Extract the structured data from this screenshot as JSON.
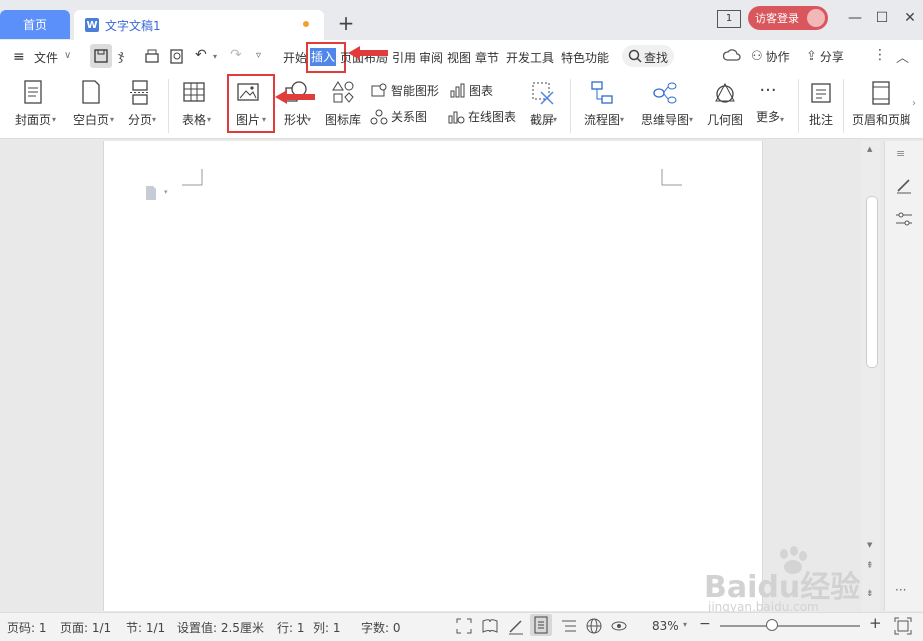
{
  "tabs": {
    "home": "首页",
    "document": "文字文稿1",
    "doc_icon": "W"
  },
  "titlebar": {
    "window_count": "1",
    "login": "访客登录"
  },
  "menu": {
    "file": "文件",
    "items": [
      "开始",
      "插入",
      "页面布局",
      "引用",
      "审阅",
      "视图",
      "章节",
      "开发工具",
      "特色功能"
    ],
    "search": "查找",
    "collab": "协作",
    "share": "分享",
    "active_tab": "插入"
  },
  "ribbon": {
    "cover": "封面页",
    "blank": "空白页",
    "pagebreak": "分页",
    "table": "表格",
    "picture": "图片",
    "shape": "形状",
    "iconlib": "图标库",
    "smartart": "智能图形",
    "chart": "图表",
    "relation": "关系图",
    "onlinechart": "在线图表",
    "screenshot": "截屏",
    "flowchart": "流程图",
    "mindmap": "思维导图",
    "geometry": "几何图",
    "more": "更多",
    "comment": "批注",
    "header_footer": "页眉和页脚"
  },
  "status": {
    "page_num": "页码: 1",
    "pages": "页面: 1/1",
    "section": "节: 1/1",
    "setting": "设置值: 2.5厘米",
    "row": "行: 1",
    "col": "列: 1",
    "words": "字数: 0",
    "zoom": "83%",
    "zoom_level": 0.83
  },
  "watermark": {
    "brand": "Baidu经验",
    "url": "jingyan.baidu.com"
  },
  "colors": {
    "accent": "#4f86e8",
    "highlight": "#e03c3c",
    "home_tab": "#5b8ff9",
    "login": "#d9575c"
  }
}
